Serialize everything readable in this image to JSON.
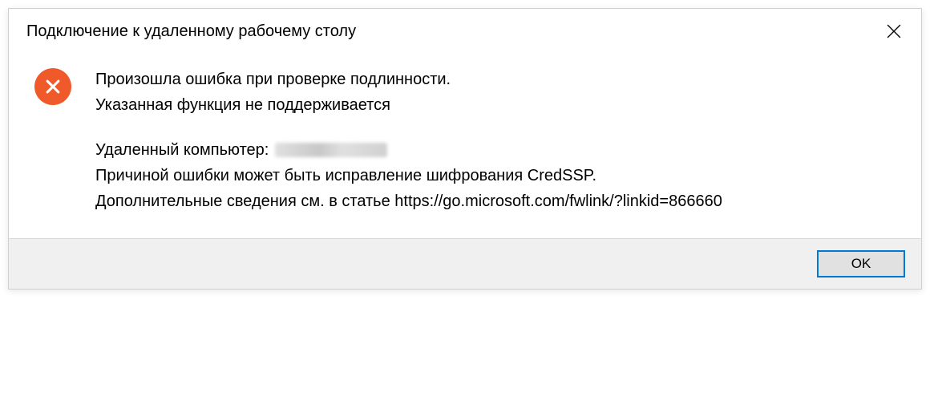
{
  "dialog": {
    "title": "Подключение к удаленному рабочему столу",
    "message": {
      "line1": "Произошла ошибка при проверке подлинности.",
      "line2": "Указанная функция не поддерживается",
      "remote_label": "Удаленный компьютер:",
      "cause": "Причиной ошибки может быть исправление шифрования CredSSP.",
      "more_info": "Дополнительные сведения см. в статье https://go.microsoft.com/fwlink/?linkid=866660"
    },
    "buttons": {
      "ok": "OK"
    }
  },
  "icons": {
    "error": "error-x-icon",
    "close": "close-icon"
  },
  "colors": {
    "error_bg": "#f0592a",
    "ok_border": "#0078d7"
  }
}
